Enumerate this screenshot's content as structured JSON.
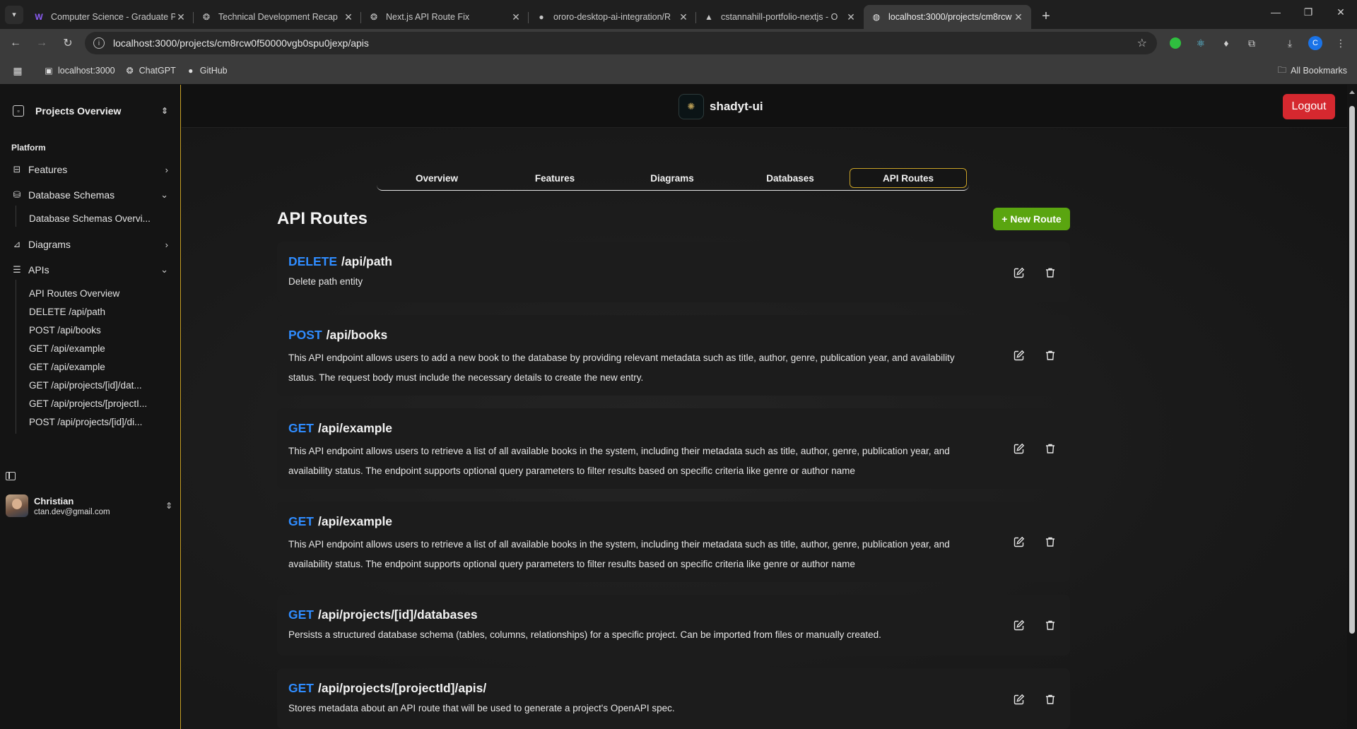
{
  "browser": {
    "tabs": [
      {
        "title": "Computer Science - Graduate P",
        "favicon": "W",
        "active": false
      },
      {
        "title": "Technical Development Recap",
        "favicon": "openai-icon",
        "active": false
      },
      {
        "title": "Next.js API Route Fix",
        "favicon": "openai-icon",
        "active": false
      },
      {
        "title": "ororo-desktop-ai-integration/R",
        "favicon": "github-icon",
        "active": false
      },
      {
        "title": "cstannahill-portfolio-nextjs - O",
        "favicon": "vercel-icon",
        "active": false
      },
      {
        "title": "localhost:3000/projects/cm8rcw",
        "favicon": "globe-icon",
        "active": true
      }
    ],
    "url": "localhost:3000/projects/cm8rcw0f50000vgb0spu0jexp/apis",
    "profile_initial": "C",
    "bookmarks": [
      {
        "label": "localhost:3000",
        "icon": "localhost-icon"
      },
      {
        "label": "ChatGPT",
        "icon": "openai-icon"
      },
      {
        "label": "GitHub",
        "icon": "github-icon"
      }
    ],
    "all_bookmarks": "All Bookmarks"
  },
  "sidebar": {
    "project_switcher": "Projects Overview",
    "group_label": "Platform",
    "items": [
      {
        "label": "Features",
        "icon": "briefcase-icon",
        "expanded": false
      },
      {
        "label": "Database Schemas",
        "icon": "database-icon",
        "expanded": true
      },
      {
        "label": "Diagrams",
        "icon": "chart-icon",
        "expanded": false
      },
      {
        "label": "APIs",
        "icon": "server-icon",
        "expanded": true
      }
    ],
    "db_sub": [
      "Database Schemas Overvi..."
    ],
    "api_sub": [
      "API Routes Overview",
      "DELETE /api/path",
      "POST /api/books",
      "GET /api/example",
      "GET /api/example",
      "GET /api/projects/[id]/dat...",
      "GET /api/projects/[projectI...",
      "POST /api/projects/[id]/di..."
    ],
    "user": {
      "name": "Christian",
      "email": "ctan.dev@gmail.com"
    }
  },
  "header": {
    "brand": "shadyt-ui",
    "logout": "Logout"
  },
  "tabs": [
    "Overview",
    "Features",
    "Diagrams",
    "Databases",
    "API Routes"
  ],
  "active_tab": "API Routes",
  "page": {
    "title": "API Routes",
    "new_route": "+ New Route"
  },
  "routes": [
    {
      "method": "DELETE",
      "path": "/api/path",
      "description": "Delete path entity"
    },
    {
      "method": "POST",
      "path": "/api/books",
      "description": "This API endpoint allows users to add a new book to the database by providing relevant metadata such as title, author, genre, publication year, and availability status. The request body must include the necessary details to create the new entry."
    },
    {
      "method": "GET",
      "path": "/api/example",
      "description": "This API endpoint allows users to retrieve a list of all available books in the system, including their metadata such as title, author, genre, publication year, and availability status. The endpoint supports optional query parameters to filter results based on specific criteria like genre or author name"
    },
    {
      "method": "GET",
      "path": "/api/example",
      "description": "This API endpoint allows users to retrieve a list of all available books in the system, including their metadata such as title, author, genre, publication year, and availability status. The endpoint supports optional query parameters to filter results based on specific criteria like genre or author name"
    },
    {
      "method": "GET",
      "path": "/api/projects/[id]/databases",
      "description": "Persists a structured database schema (tables, columns, relationships) for a specific project. Can be imported from files or manually created."
    },
    {
      "method": "GET",
      "path": "/api/projects/[projectId]/apis/",
      "description": "Stores metadata about an API route that will be used to generate a project's OpenAPI spec."
    }
  ],
  "colors": {
    "method": "#2f8cff",
    "accent": "#c9a227",
    "logout": "#d5282f",
    "new_route": "#5aa510"
  }
}
